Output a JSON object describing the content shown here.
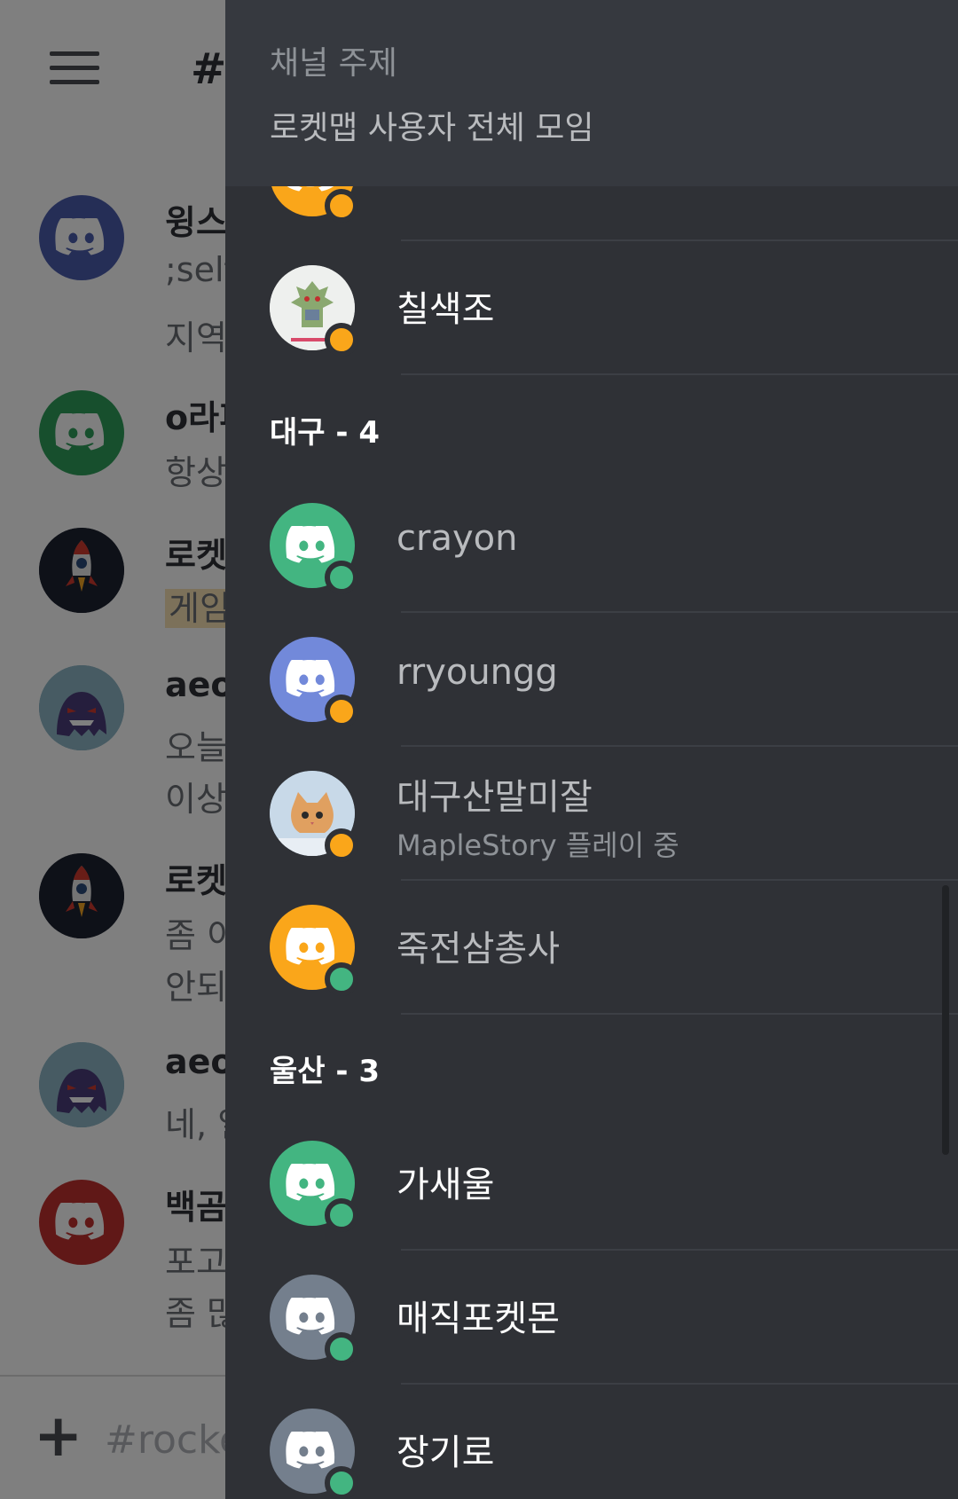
{
  "background": {
    "channel_hash": "#",
    "messages": [
      {
        "name": "윙스",
        "lines": [
          ";self",
          "지역"
        ],
        "avatar_color": "#4b5cad",
        "avatar": "discord-icon"
      },
      {
        "name": "o라피",
        "lines": [
          "항상"
        ],
        "avatar_color": "#2e9e5b",
        "avatar": "discord-icon"
      },
      {
        "name": "로켓",
        "lines": [
          "게임"
        ],
        "avatar_color": "#1c2230",
        "avatar": "rocket-icon"
      },
      {
        "name": "aeol",
        "lines": [
          "오늘",
          "이상"
        ],
        "avatar_color": "#6aa0b5",
        "avatar": "ghost-icon"
      },
      {
        "name": "로켓",
        "lines": [
          "좀 이",
          "안되"
        ],
        "avatar_color": "#1c2230",
        "avatar": "rocket-icon"
      },
      {
        "name": "aeol",
        "lines": [
          "네, 일"
        ],
        "avatar_color": "#6aa0b5",
        "avatar": "ghost-icon"
      },
      {
        "name": "백곰",
        "lines": [
          "포고",
          "좀 많"
        ],
        "avatar_color": "#c0302f",
        "avatar": "discord-icon"
      }
    ],
    "composer_placeholder": "#rocke"
  },
  "drawer": {
    "topic_label": "채널 주제",
    "topic_text": "로켓맵 사용자 전체 모임",
    "sections": [
      {
        "label": "대구 - 4"
      },
      {
        "label": "울산 - 3"
      }
    ],
    "members": [
      {
        "name": "",
        "avatar_color": "#faa61a",
        "status": "idle",
        "avatar": "discord-icon"
      },
      {
        "name": "칠색조",
        "avatar_color": "#e9ecef",
        "status": "idle",
        "avatar": "pokemon-icon"
      },
      {
        "name": "crayon",
        "avatar_color": "#43b581",
        "status": "online",
        "avatar": "discord-icon"
      },
      {
        "name": "rryoungg",
        "avatar_color": "#7289da",
        "status": "idle",
        "avatar": "discord-icon"
      },
      {
        "name": "대구산말미잘",
        "activity": "MapleStory 플레이 중",
        "avatar_color": "#b9cfe0",
        "status": "idle",
        "avatar": "kitten-icon"
      },
      {
        "name": "죽전삼총사",
        "avatar_color": "#faa61a",
        "status": "online",
        "avatar": "discord-icon"
      },
      {
        "name": "가새울",
        "avatar_color": "#43b581",
        "status": "online",
        "avatar": "discord-icon"
      },
      {
        "name": "매직포켓몬",
        "avatar_color": "#747f8d",
        "status": "online",
        "avatar": "discord-icon"
      },
      {
        "name": "장기로",
        "avatar_color": "#747f8d",
        "status": "online",
        "avatar": "discord-icon"
      }
    ]
  },
  "colors": {
    "online": "#43b581",
    "idle": "#faa61a",
    "drawer_bg": "#2f3136",
    "topic_bg": "#36393f"
  }
}
